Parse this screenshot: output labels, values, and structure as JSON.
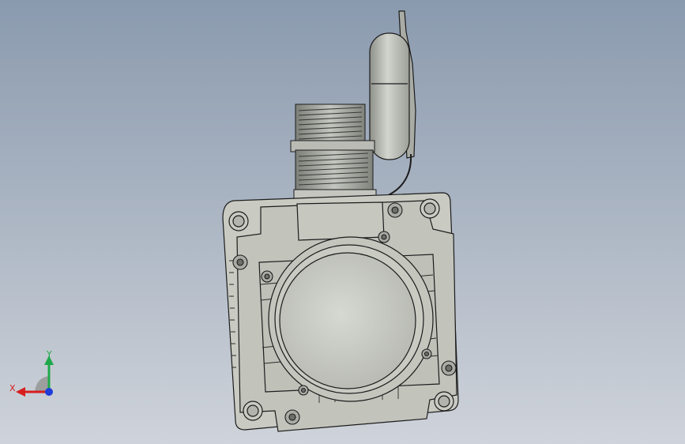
{
  "viewport": {
    "background_top": "#8a9aae",
    "background_bottom": "#cfd3da"
  },
  "model": {
    "part_color": "#c9cbc3",
    "edge_color": "#1c1c1c"
  },
  "triad": {
    "x_label": "X",
    "y_label": "Y",
    "x_color": "#d81e1e",
    "y_color": "#1fa84a",
    "z_color": "#1e3cd8"
  }
}
